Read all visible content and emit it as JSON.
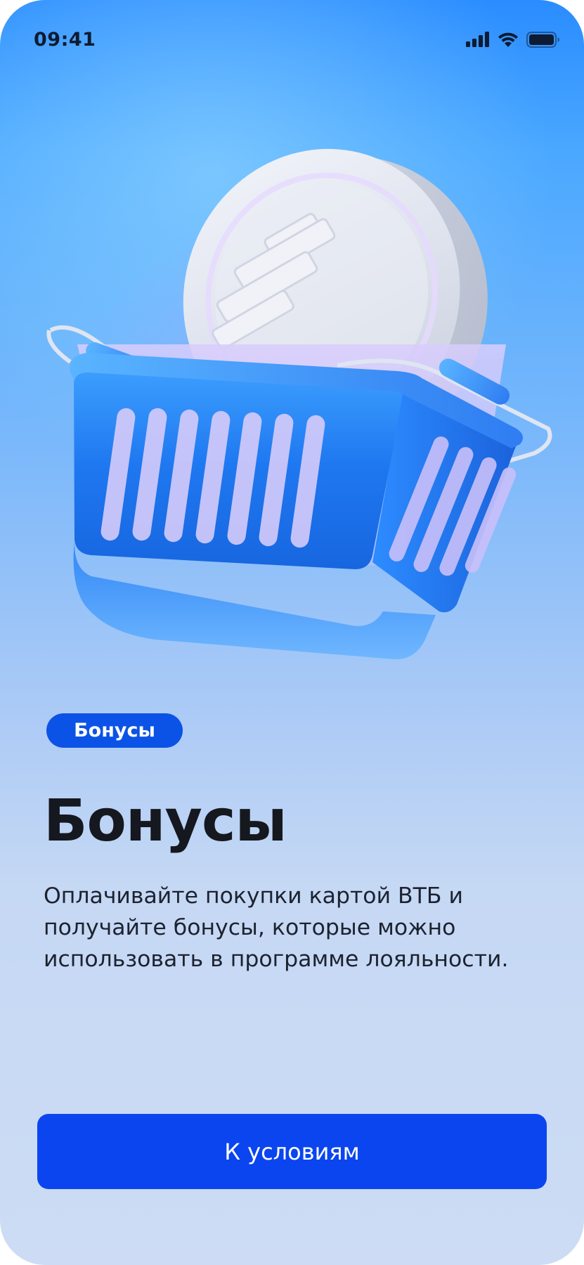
{
  "status_bar": {
    "time": "09:41",
    "icons": [
      "signal-icon",
      "wifi-icon",
      "battery-icon"
    ]
  },
  "hero": {
    "illustration": "shopping-basket-with-coin"
  },
  "tag": {
    "label": "Бонусы"
  },
  "title": "Бонусы",
  "description": "Оплачивайте покупки картой ВТБ и получайте бонусы, которые можно использовать в программе лояльности.",
  "cta": {
    "label": "К условиям"
  },
  "colors": {
    "accent": "#0a45ef",
    "tag_bg": "#0b53e6",
    "text": "#15181e"
  }
}
